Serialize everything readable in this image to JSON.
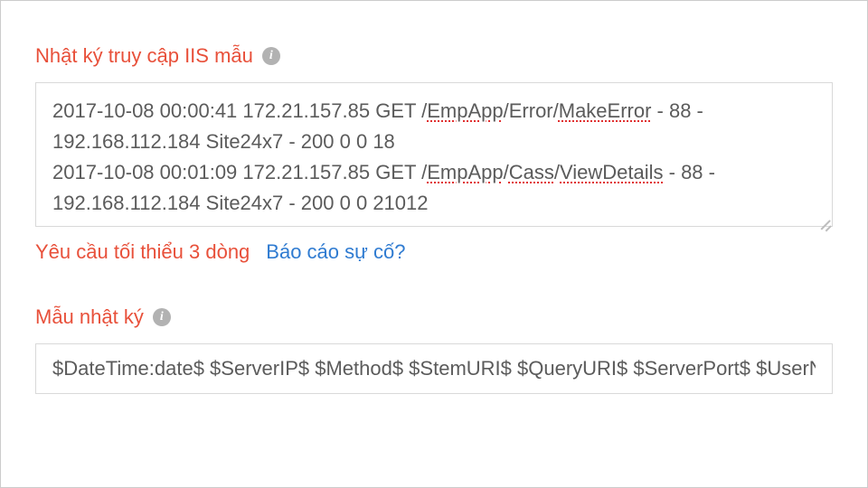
{
  "section1": {
    "label": "Nhật ký truy cập IIS mẫu",
    "sample_log": "2017-10-08 00:00:41 172.21.157.85 GET /EmpApp/Error/MakeError - 88 - 192.168.112.184 Site24x7 - 200 0 0 18\n2017-10-08 00:01:09 172.21.157.85 GET /EmpApp/Cass/ViewDetails - 88 - 192.168.112.184 Site24x7 - 200 0 0 21012",
    "hint_error": "Yêu cầu tối thiểu 3 dòng",
    "hint_link": "Báo cáo sự cố?",
    "spell_words": [
      "EmpApp",
      "MakeError",
      "EmpApp",
      "Cass",
      "ViewDetails"
    ]
  },
  "section2": {
    "label": "Mẫu nhật ký",
    "pattern": "$DateTime:date$ $ServerIP$ $Method$ $StemURI$ $QueryURI$ $ServerPort$ $UserName$"
  }
}
